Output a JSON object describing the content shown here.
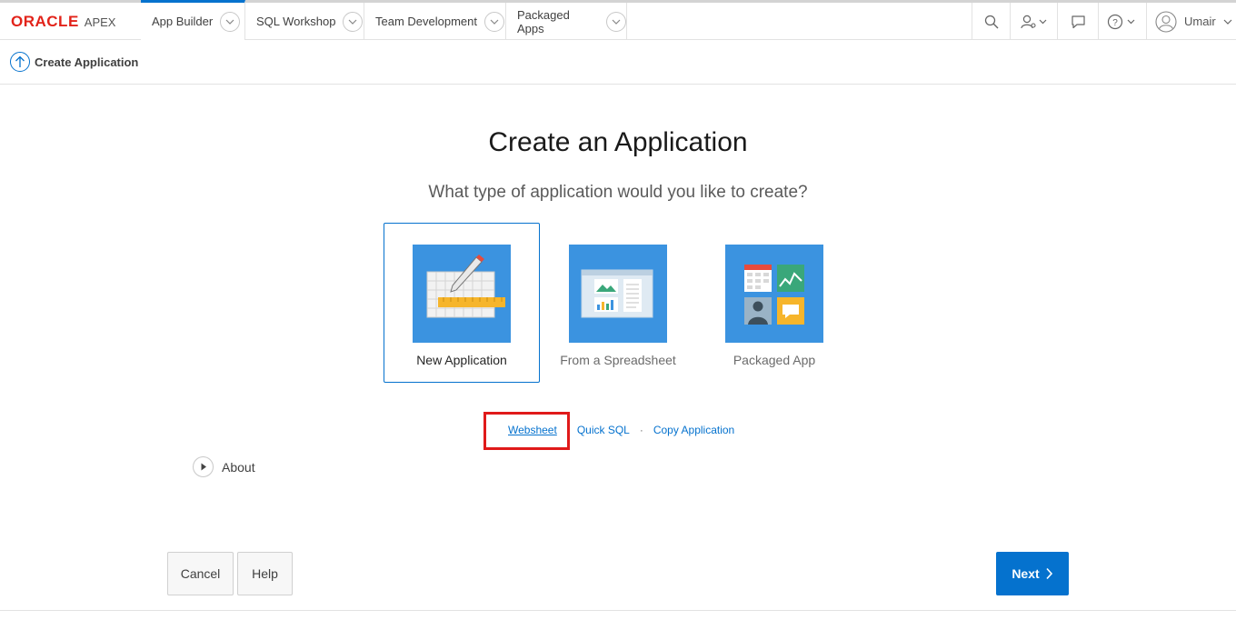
{
  "logo": {
    "oracle": "ORACLE",
    "apex": "APEX",
    "brand_color": "#e2231a"
  },
  "nav": {
    "tabs": [
      {
        "label": "App Builder",
        "active": true
      },
      {
        "label": "SQL Workshop",
        "active": false
      },
      {
        "label": "Team Development",
        "active": false
      },
      {
        "label": "Packaged Apps",
        "active": false
      }
    ],
    "user": "Umair"
  },
  "breadcrumb": {
    "label": "Create Application"
  },
  "main": {
    "title": "Create an Application",
    "subtitle": "What type of application would you like to create?",
    "cards": [
      {
        "label": "New Application",
        "icon": "grid-pencil-icon",
        "selected": true
      },
      {
        "label": "From a Spreadsheet",
        "icon": "spreadsheet-icon",
        "selected": false
      },
      {
        "label": "Packaged App",
        "icon": "packaged-app-icon",
        "selected": false
      }
    ],
    "links": {
      "websheet": "Websheet",
      "quick_sql": "Quick SQL",
      "separator": "·",
      "copy_app": "Copy Application"
    },
    "about": "About"
  },
  "buttons": {
    "cancel": "Cancel",
    "help": "Help",
    "next": "Next"
  },
  "colors": {
    "accent": "#0572ce",
    "tile": "#3b93e0",
    "highlight": "#e01a1a"
  }
}
